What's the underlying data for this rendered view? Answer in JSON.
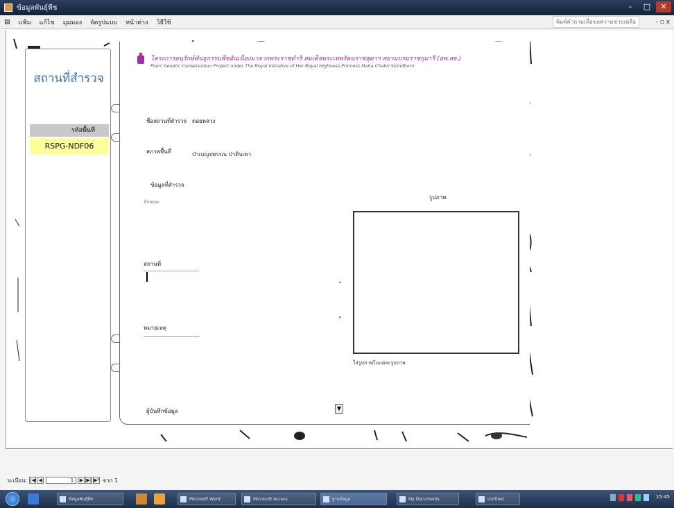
{
  "window": {
    "title": "ข้อมูลพันธุ์พืช",
    "minimize": "–",
    "maximize": "□",
    "close": "✕"
  },
  "menu": {
    "items": [
      "แฟ้ม",
      "แก้ไข",
      "มุมมอง",
      "จัดรูปแบบ",
      "หน้าต่าง",
      "วิธีใช้"
    ],
    "help_box": "พิมพ์คำถามเพื่อขอความช่วยเหลือ",
    "mdi_controls": "- ▫ x"
  },
  "left_panel": {
    "heading": "สถานที่สำรวจ",
    "code_header": "รหัสพื้นที่",
    "code_value": "RSPG-NDF06"
  },
  "header": {
    "line1": "โครงการอนุรักษ์พันธุกรรมพืชอันเนื่องมาจากพระราชดำริ สมเด็จพระเทพรัตนราชสุดาฯ สยามบรมราชกุมารี (อพ.สธ.)",
    "line2": "Plant Genetic Conservation Project under The Royal Initiative of Her Royal Highness Princess Maha Chakri Sirindhorn"
  },
  "form": {
    "site_name_label": "ชื่อสถานที่สำรวจ",
    "site_name_value": "ดอยหลวง",
    "area_label": "สภาพพื้นที่",
    "area_value": "ป่าเบญจพรรณ ป่าดิบเขา",
    "details_label": "ข้อมูลที่สำรวจ",
    "sub_label1": "ลักษณะ",
    "sub_label2": "สถานที่",
    "sub_label3": "หมายเหตุ",
    "recorder_label": "ผู้บันทึกข้อมูล",
    "image_label": "รูปภาพ",
    "image_caption": "ใส่รูปภาพในแต่ละรูปภาพ",
    "combo_arrow": "▼"
  },
  "record_nav": {
    "label": "ระเบียน:",
    "first": "|◀",
    "prev": "◀",
    "current": "1",
    "next": "▶",
    "last": "▶|",
    "new": "▶*",
    "total": "จาก 1"
  },
  "taskbar": {
    "tasks": [
      "ข้อมูลพันธุ์พืช",
      "Microsoft Word",
      "Microsoft Access",
      "ฐานข้อมูล",
      "My Documents",
      "Untitled"
    ],
    "clock": "15:45"
  },
  "colors": {
    "heading_blue": "#3b6fb3",
    "highlight_yellow": "#ffff9c",
    "header_purple": "#9b2fb0",
    "taskbar": "#1d2f4a"
  }
}
